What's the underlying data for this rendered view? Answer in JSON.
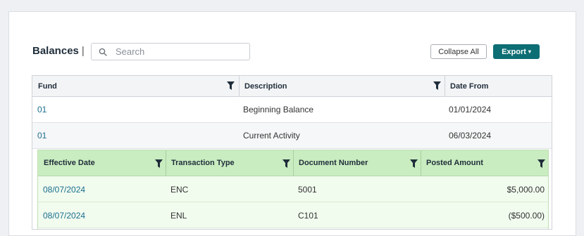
{
  "toolbar": {
    "title": "Balances",
    "separator": "|",
    "search_placeholder": "Search",
    "collapse_label": "Collapse All",
    "export_label": "Export",
    "export_caret": "▾"
  },
  "outer_table": {
    "columns": [
      "Fund",
      "Description",
      "Date From"
    ],
    "rows": [
      {
        "fund": "01",
        "description": "Beginning Balance",
        "date_from": "01/01/2024"
      },
      {
        "fund": "01",
        "description": "Current Activity",
        "date_from": "06/03/2024"
      }
    ]
  },
  "inner_table": {
    "columns": [
      "Effective Date",
      "Transaction Type",
      "Document Number",
      "Posted Amount"
    ],
    "rows": [
      {
        "effective_date": "08/07/2024",
        "transaction_type": "ENC",
        "document_number": "5001",
        "posted_amount": "$5,000.00"
      },
      {
        "effective_date": "08/07/2024",
        "transaction_type": "ENL",
        "document_number": "C101",
        "posted_amount": "($500.00)"
      }
    ]
  },
  "colors": {
    "accent": "#0d6e74",
    "link": "#1a6f8f",
    "inner_header": "#c9ecc0",
    "inner_row": "#f1fbee"
  },
  "icons": [
    "search-icon",
    "filter-icon",
    "caret-down-icon"
  ]
}
